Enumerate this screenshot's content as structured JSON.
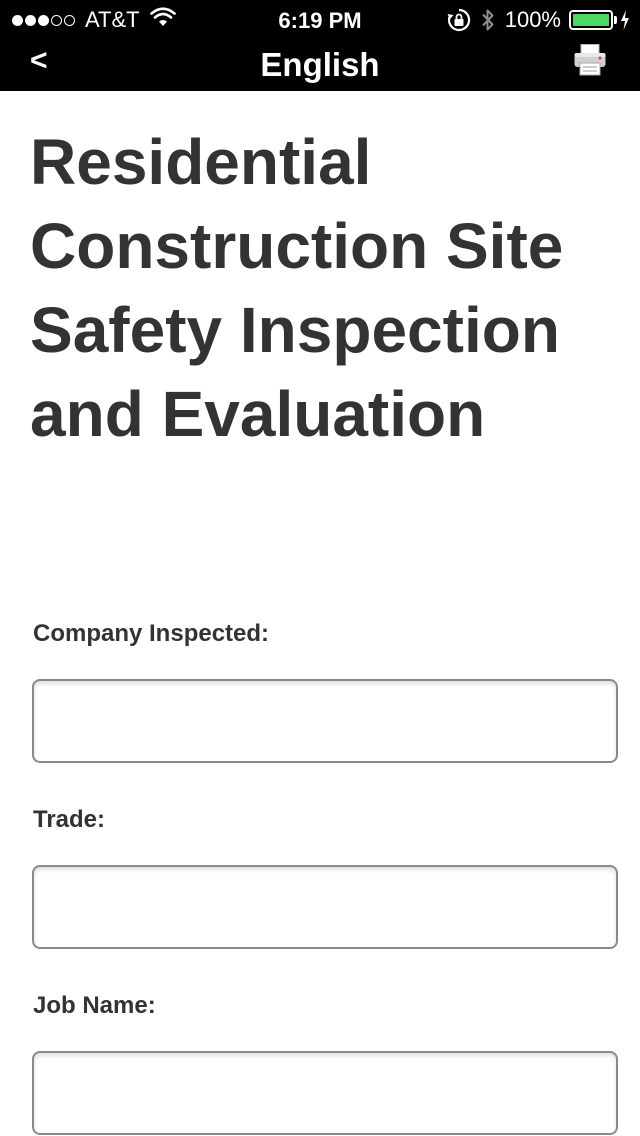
{
  "status_bar": {
    "carrier": "AT&T",
    "signal_bars": 3,
    "signal_bars_total": 5,
    "time": "6:19 PM",
    "battery_percent": "100%",
    "battery_color": "#4cd964"
  },
  "nav": {
    "back_label": "<",
    "title": "English",
    "print_icon": "printer-icon"
  },
  "page": {
    "title": "Residential Construction Site Safety Inspection and Evaluation"
  },
  "form": {
    "fields": [
      {
        "label": "Company Inspected:",
        "value": "",
        "placeholder": ""
      },
      {
        "label": "Trade:",
        "value": "",
        "placeholder": ""
      },
      {
        "label": "Job Name:",
        "value": "",
        "placeholder": ""
      }
    ]
  }
}
